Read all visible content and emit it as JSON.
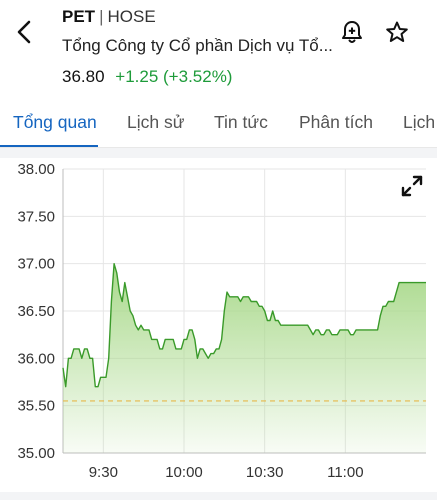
{
  "header": {
    "ticker": "PET",
    "separator": "|",
    "exchange": "HOSE",
    "company_name": "Tổng Công ty Cổ phần Dịch vụ Tổ...",
    "price": "36.80",
    "change": "+1.25 (+3.52%)",
    "change_color": "#1e9b3a"
  },
  "icons": {
    "back": "back-chevron-icon",
    "bell": "bell-plus-icon",
    "star": "star-icon",
    "expand": "expand-icon"
  },
  "tabs": [
    {
      "label": "Tổng quan",
      "active": true
    },
    {
      "label": "Lịch sử",
      "active": false
    },
    {
      "label": "Tin tức",
      "active": false
    },
    {
      "label": "Phân tích",
      "active": false
    },
    {
      "label": "Lịch",
      "active": false
    }
  ],
  "colors": {
    "accent": "#1565c0",
    "line": "#3a9a2a",
    "fill_top": "#a9d98b",
    "reference_line": "#e7b84a"
  },
  "chart_data": {
    "type": "area",
    "title": "",
    "xlabel": "",
    "ylabel": "",
    "ylim": [
      35.0,
      38.0
    ],
    "yticks": [
      "38.00",
      "37.50",
      "37.00",
      "36.50",
      "36.00",
      "35.50",
      "35.00"
    ],
    "xticks": [
      "9:30",
      "10:00",
      "10:30",
      "11:00"
    ],
    "reference_price": 35.55,
    "grid": true,
    "series": [
      {
        "x": [
          "9:15",
          "9:16",
          "9:17",
          "9:18",
          "9:19",
          "9:20",
          "9:21",
          "9:22",
          "9:23",
          "9:24",
          "9:25",
          "9:26",
          "9:27",
          "9:28",
          "9:29",
          "9:30",
          "9:31",
          "9:32",
          "9:33",
          "9:34",
          "9:35",
          "9:36",
          "9:37",
          "9:38",
          "9:39",
          "9:40",
          "9:41",
          "9:42",
          "9:43",
          "9:44",
          "9:45",
          "9:46",
          "9:47",
          "9:48",
          "9:49",
          "9:50",
          "9:51",
          "9:52",
          "9:53",
          "9:54",
          "9:55",
          "9:56",
          "9:57",
          "9:58",
          "9:59",
          "10:00",
          "10:01",
          "10:02",
          "10:03",
          "10:04",
          "10:05",
          "10:06",
          "10:07",
          "10:08",
          "10:09",
          "10:10",
          "10:11",
          "10:12",
          "10:13",
          "10:14",
          "10:15",
          "10:16",
          "10:17",
          "10:18",
          "10:19",
          "10:20",
          "10:21",
          "10:22",
          "10:23",
          "10:24",
          "10:25",
          "10:26",
          "10:27",
          "10:28",
          "10:29",
          "10:30",
          "10:31",
          "10:32",
          "10:33",
          "10:34",
          "10:35",
          "10:36",
          "10:37",
          "10:38",
          "10:39",
          "10:40",
          "10:41",
          "10:42",
          "10:43",
          "10:44",
          "10:45",
          "10:46",
          "10:47",
          "10:48",
          "10:49",
          "10:50",
          "10:51",
          "10:52",
          "10:53",
          "10:54",
          "10:55",
          "10:56",
          "10:57",
          "10:58",
          "10:59",
          "11:00",
          "11:01",
          "11:02",
          "11:03",
          "11:04",
          "11:05",
          "11:06",
          "11:07",
          "11:08",
          "11:09",
          "11:10",
          "11:11",
          "11:12",
          "11:13",
          "11:14",
          "11:15",
          "11:16",
          "11:17",
          "11:18",
          "11:19",
          "11:20",
          "11:21",
          "11:22",
          "11:23",
          "11:24",
          "11:25",
          "11:26",
          "11:27",
          "11:28",
          "11:29",
          "11:30"
        ],
        "values": [
          35.9,
          35.7,
          36.0,
          36.0,
          36.1,
          36.1,
          36.1,
          36.0,
          36.1,
          36.1,
          36.0,
          36.0,
          35.7,
          35.7,
          35.8,
          35.8,
          35.8,
          36.0,
          36.6,
          37.0,
          36.9,
          36.7,
          36.6,
          36.8,
          36.65,
          36.5,
          36.45,
          36.35,
          36.3,
          36.35,
          36.3,
          36.3,
          36.3,
          36.2,
          36.2,
          36.2,
          36.1,
          36.1,
          36.2,
          36.2,
          36.2,
          36.2,
          36.1,
          36.1,
          36.1,
          36.2,
          36.2,
          36.3,
          36.3,
          36.2,
          36.0,
          36.1,
          36.1,
          36.05,
          36.0,
          36.05,
          36.05,
          36.1,
          36.1,
          36.2,
          36.5,
          36.7,
          36.65,
          36.65,
          36.65,
          36.65,
          36.6,
          36.65,
          36.65,
          36.65,
          36.6,
          36.6,
          36.6,
          36.55,
          36.55,
          36.5,
          36.4,
          36.4,
          36.5,
          36.4,
          36.4,
          36.35,
          36.35,
          36.35,
          36.35,
          36.35,
          36.35,
          36.35,
          36.35,
          36.35,
          36.35,
          36.35,
          36.3,
          36.25,
          36.3,
          36.3,
          36.25,
          36.25,
          36.3,
          36.3,
          36.25,
          36.25,
          36.25,
          36.3,
          36.3,
          36.3,
          36.3,
          36.25,
          36.25,
          36.3,
          36.3,
          36.3,
          36.3,
          36.3,
          36.3,
          36.3,
          36.3,
          36.3,
          36.45,
          36.55,
          36.55,
          36.6,
          36.6,
          36.6,
          36.7,
          36.8,
          36.8,
          36.8,
          36.8,
          36.8,
          36.8,
          36.8,
          36.8,
          36.8,
          36.8,
          36.8
        ]
      }
    ]
  }
}
